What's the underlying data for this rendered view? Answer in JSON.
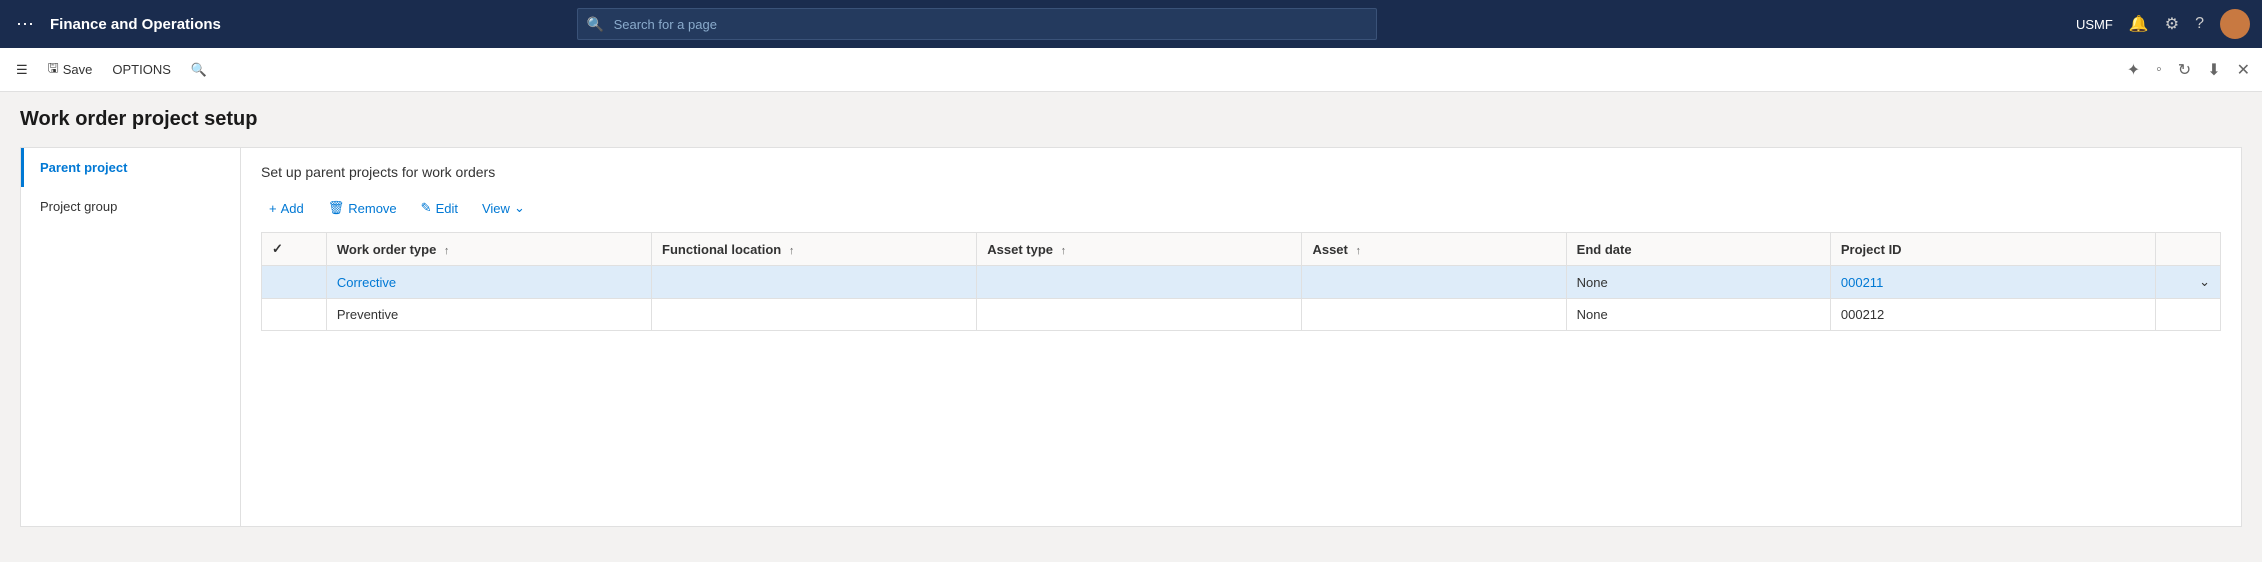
{
  "app": {
    "title": "Finance and Operations"
  },
  "search": {
    "placeholder": "Search for a page"
  },
  "topnav": {
    "company": "USMF"
  },
  "toolbar": {
    "save_label": "Save",
    "options_label": "OPTIONS"
  },
  "page": {
    "title": "Work order project setup"
  },
  "sidebar": {
    "items": [
      {
        "label": "Parent project",
        "active": true
      },
      {
        "label": "Project group",
        "active": false
      }
    ]
  },
  "panel": {
    "description": "Set up parent projects for work orders",
    "actions": {
      "add": "Add",
      "remove": "Remove",
      "edit": "Edit",
      "view": "View"
    }
  },
  "table": {
    "columns": [
      {
        "label": "Work order type",
        "sort": "↑"
      },
      {
        "label": "Functional location",
        "sort": "↑"
      },
      {
        "label": "Asset type",
        "sort": "↑"
      },
      {
        "label": "Asset",
        "sort": "↑"
      },
      {
        "label": "End date"
      },
      {
        "label": "Project ID"
      }
    ],
    "rows": [
      {
        "selected": true,
        "work_order_type": "Corrective",
        "functional_location": "",
        "asset_type": "",
        "asset": "",
        "end_date": "None",
        "project_id": "000211",
        "has_chevron": true
      },
      {
        "selected": false,
        "work_order_type": "Preventive",
        "functional_location": "",
        "asset_type": "",
        "asset": "",
        "end_date": "None",
        "project_id": "000212",
        "has_chevron": false
      }
    ]
  }
}
